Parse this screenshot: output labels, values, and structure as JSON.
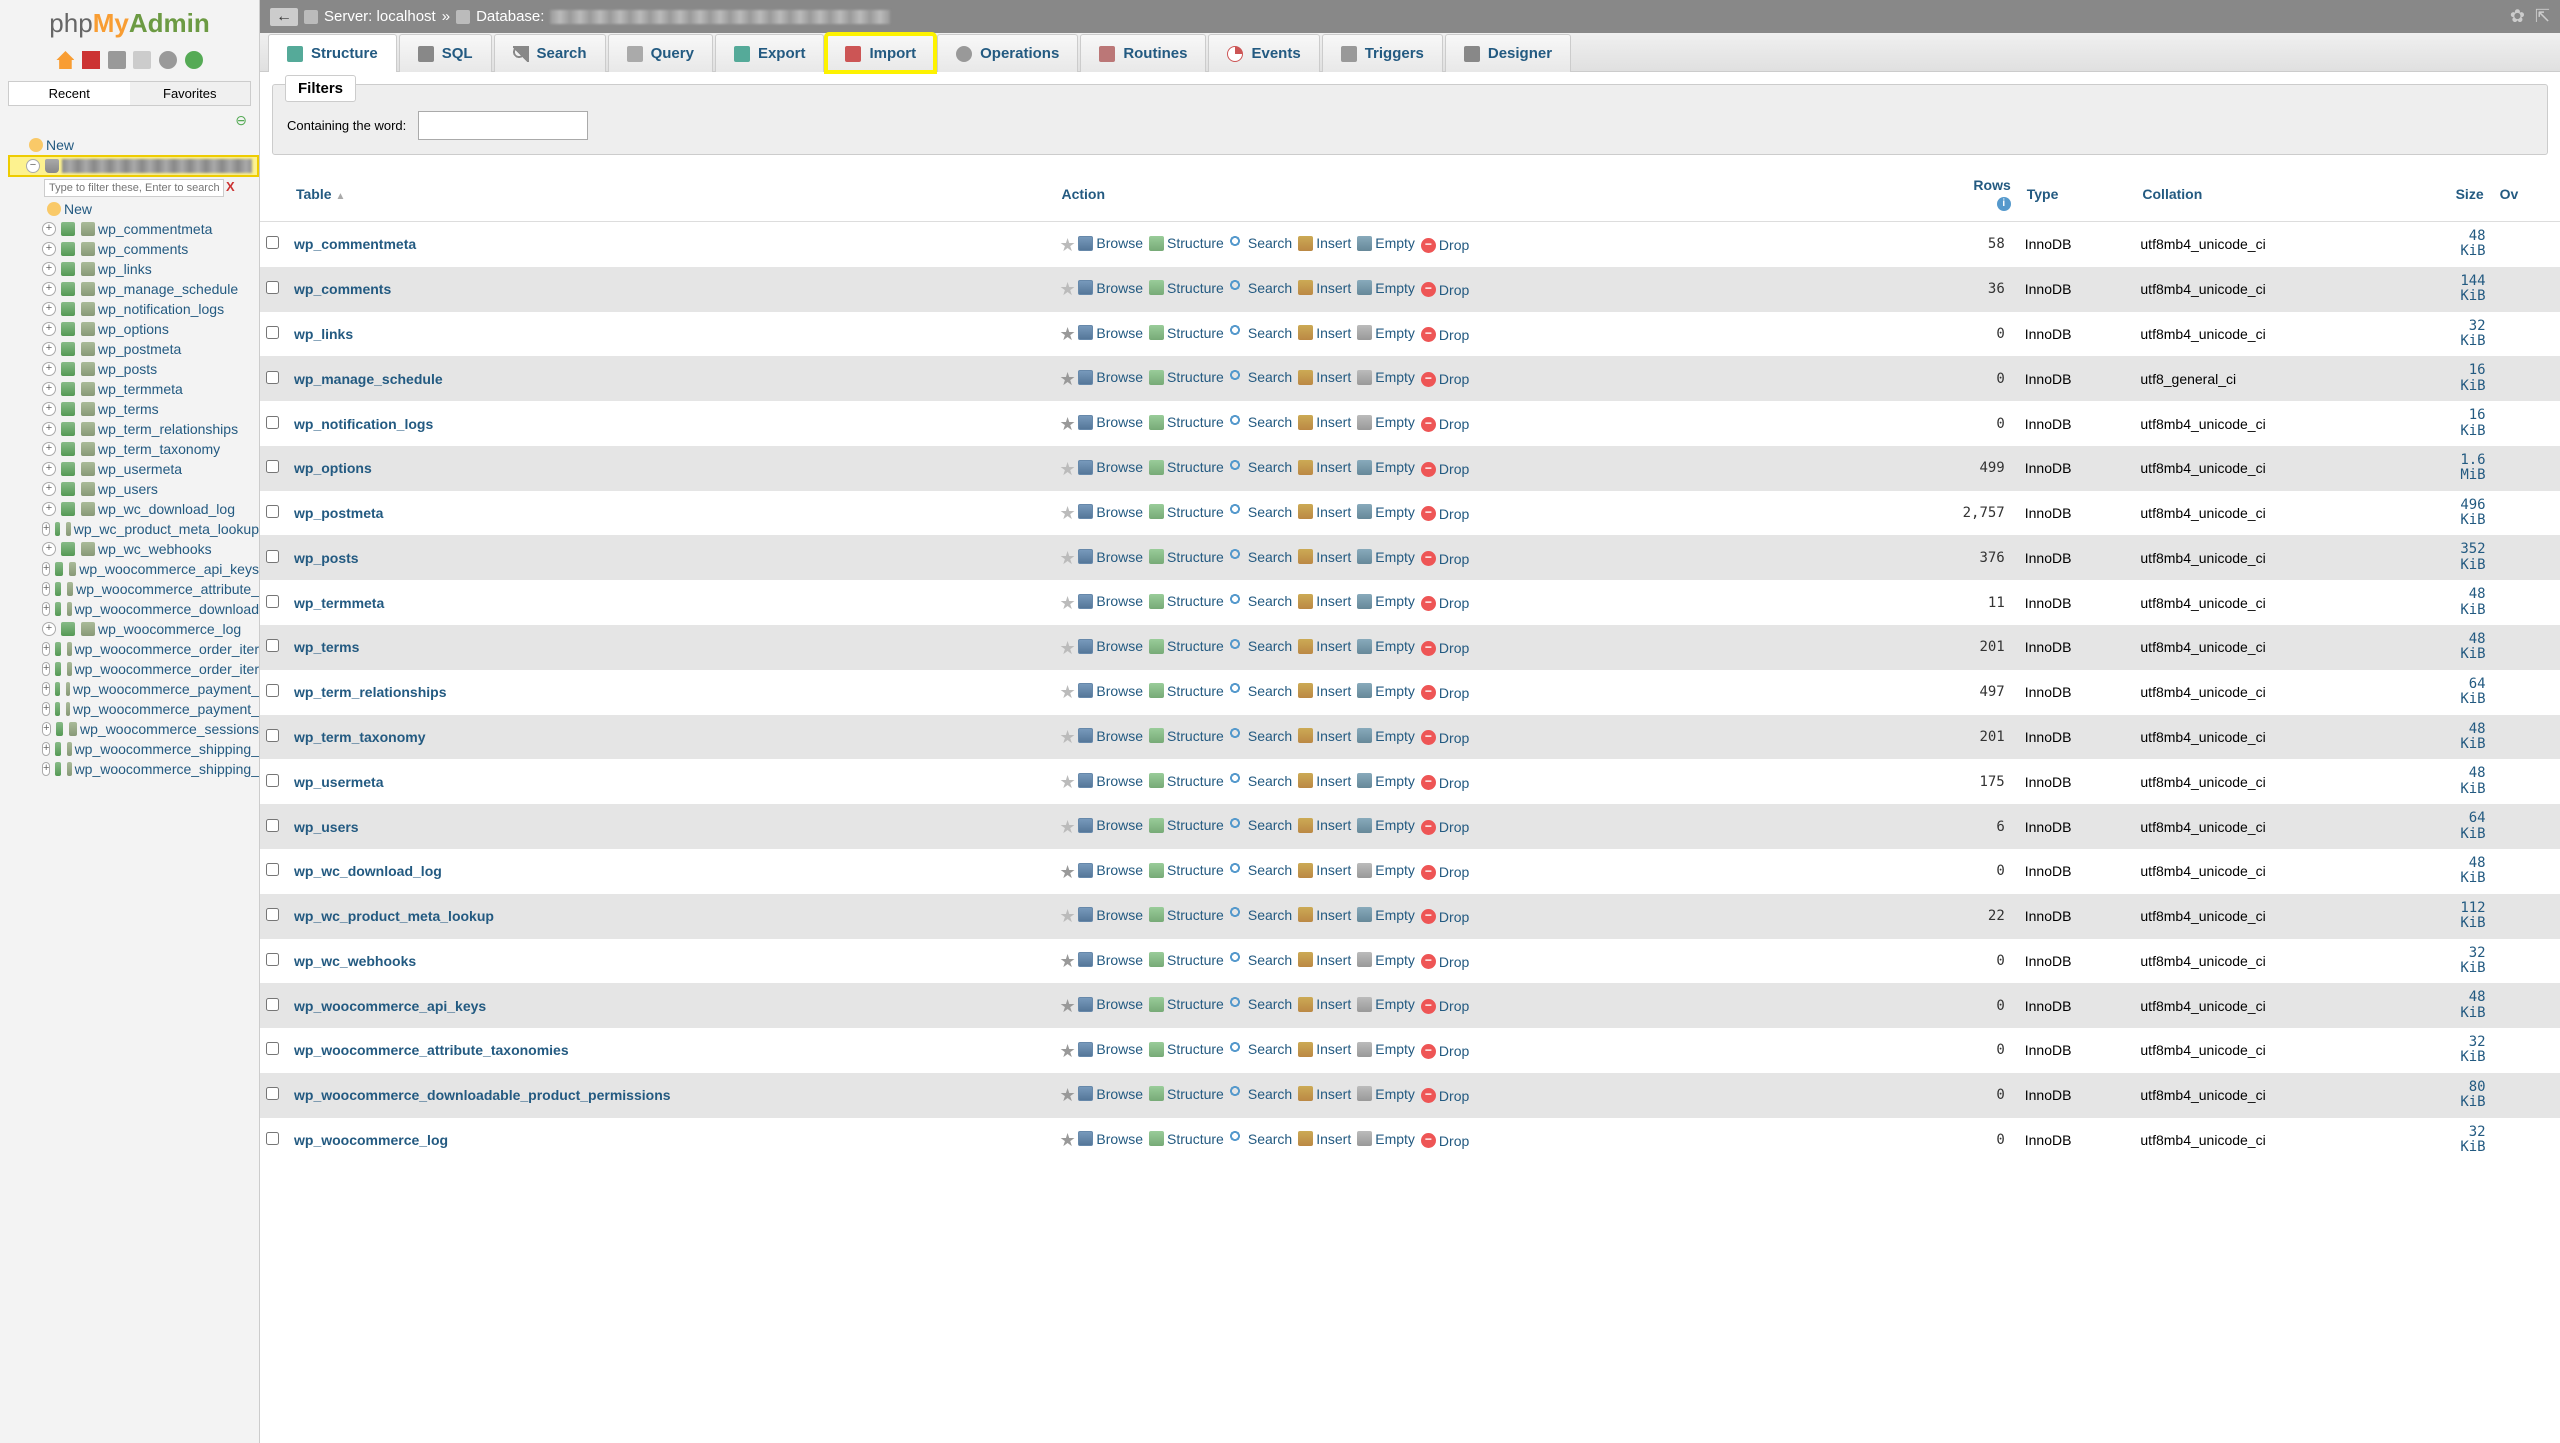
{
  "logo": {
    "php": "php",
    "my": "My",
    "admin": "Admin"
  },
  "sidebar": {
    "recent": "Recent",
    "favorites": "Favorites",
    "new_label": "New",
    "filter_placeholder": "Type to filter these, Enter to search",
    "tree_tables": [
      "wp_commentmeta",
      "wp_comments",
      "wp_links",
      "wp_manage_schedule",
      "wp_notification_logs",
      "wp_options",
      "wp_postmeta",
      "wp_posts",
      "wp_termmeta",
      "wp_terms",
      "wp_term_relationships",
      "wp_term_taxonomy",
      "wp_usermeta",
      "wp_users",
      "wp_wc_download_log",
      "wp_wc_product_meta_lookup",
      "wp_wc_webhooks",
      "wp_woocommerce_api_keys",
      "wp_woocommerce_attribute_",
      "wp_woocommerce_download",
      "wp_woocommerce_log",
      "wp_woocommerce_order_iter",
      "wp_woocommerce_order_iter",
      "wp_woocommerce_payment_",
      "wp_woocommerce_payment_",
      "wp_woocommerce_sessions",
      "wp_woocommerce_shipping_",
      "wp_woocommerce_shipping_"
    ]
  },
  "breadcrumb": {
    "server_label": "Server: localhost",
    "db_label": "Database:"
  },
  "tabs": [
    "Structure",
    "SQL",
    "Search",
    "Query",
    "Export",
    "Import",
    "Operations",
    "Routines",
    "Events",
    "Triggers",
    "Designer"
  ],
  "filters": {
    "legend": "Filters",
    "containing": "Containing the word:"
  },
  "columns": {
    "table": "Table",
    "action": "Action",
    "rows": "Rows",
    "type": "Type",
    "collation": "Collation",
    "size": "Size",
    "overhead": "Ov"
  },
  "actions": {
    "browse": "Browse",
    "structure": "Structure",
    "search": "Search",
    "insert": "Insert",
    "empty": "Empty",
    "drop": "Drop"
  },
  "rows": [
    {
      "name": "wp_commentmeta",
      "rows": "58",
      "type": "InnoDB",
      "coll": "utf8mb4_unicode_ci",
      "size": "48",
      "unit": "KiB",
      "hasdata": true
    },
    {
      "name": "wp_comments",
      "rows": "36",
      "type": "InnoDB",
      "coll": "utf8mb4_unicode_ci",
      "size": "144",
      "unit": "KiB",
      "hasdata": true
    },
    {
      "name": "wp_links",
      "rows": "0",
      "type": "InnoDB",
      "coll": "utf8mb4_unicode_ci",
      "size": "32",
      "unit": "KiB",
      "hasdata": false
    },
    {
      "name": "wp_manage_schedule",
      "rows": "0",
      "type": "InnoDB",
      "coll": "utf8_general_ci",
      "size": "16",
      "unit": "KiB",
      "hasdata": false
    },
    {
      "name": "wp_notification_logs",
      "rows": "0",
      "type": "InnoDB",
      "coll": "utf8mb4_unicode_ci",
      "size": "16",
      "unit": "KiB",
      "hasdata": false
    },
    {
      "name": "wp_options",
      "rows": "499",
      "type": "InnoDB",
      "coll": "utf8mb4_unicode_ci",
      "size": "1.6",
      "unit": "MiB",
      "hasdata": true
    },
    {
      "name": "wp_postmeta",
      "rows": "2,757",
      "type": "InnoDB",
      "coll": "utf8mb4_unicode_ci",
      "size": "496",
      "unit": "KiB",
      "hasdata": true
    },
    {
      "name": "wp_posts",
      "rows": "376",
      "type": "InnoDB",
      "coll": "utf8mb4_unicode_ci",
      "size": "352",
      "unit": "KiB",
      "hasdata": true
    },
    {
      "name": "wp_termmeta",
      "rows": "11",
      "type": "InnoDB",
      "coll": "utf8mb4_unicode_ci",
      "size": "48",
      "unit": "KiB",
      "hasdata": true
    },
    {
      "name": "wp_terms",
      "rows": "201",
      "type": "InnoDB",
      "coll": "utf8mb4_unicode_ci",
      "size": "48",
      "unit": "KiB",
      "hasdata": true
    },
    {
      "name": "wp_term_relationships",
      "rows": "497",
      "type": "InnoDB",
      "coll": "utf8mb4_unicode_ci",
      "size": "64",
      "unit": "KiB",
      "hasdata": true
    },
    {
      "name": "wp_term_taxonomy",
      "rows": "201",
      "type": "InnoDB",
      "coll": "utf8mb4_unicode_ci",
      "size": "48",
      "unit": "KiB",
      "hasdata": true
    },
    {
      "name": "wp_usermeta",
      "rows": "175",
      "type": "InnoDB",
      "coll": "utf8mb4_unicode_ci",
      "size": "48",
      "unit": "KiB",
      "hasdata": true
    },
    {
      "name": "wp_users",
      "rows": "6",
      "type": "InnoDB",
      "coll": "utf8mb4_unicode_ci",
      "size": "64",
      "unit": "KiB",
      "hasdata": true
    },
    {
      "name": "wp_wc_download_log",
      "rows": "0",
      "type": "InnoDB",
      "coll": "utf8mb4_unicode_ci",
      "size": "48",
      "unit": "KiB",
      "hasdata": false
    },
    {
      "name": "wp_wc_product_meta_lookup",
      "rows": "22",
      "type": "InnoDB",
      "coll": "utf8mb4_unicode_ci",
      "size": "112",
      "unit": "KiB",
      "hasdata": true
    },
    {
      "name": "wp_wc_webhooks",
      "rows": "0",
      "type": "InnoDB",
      "coll": "utf8mb4_unicode_ci",
      "size": "32",
      "unit": "KiB",
      "hasdata": false
    },
    {
      "name": "wp_woocommerce_api_keys",
      "rows": "0",
      "type": "InnoDB",
      "coll": "utf8mb4_unicode_ci",
      "size": "48",
      "unit": "KiB",
      "hasdata": false
    },
    {
      "name": "wp_woocommerce_attribute_taxonomies",
      "rows": "0",
      "type": "InnoDB",
      "coll": "utf8mb4_unicode_ci",
      "size": "32",
      "unit": "KiB",
      "hasdata": false
    },
    {
      "name": "wp_woocommerce_downloadable_product_permissions",
      "rows": "0",
      "type": "InnoDB",
      "coll": "utf8mb4_unicode_ci",
      "size": "80",
      "unit": "KiB",
      "hasdata": false
    },
    {
      "name": "wp_woocommerce_log",
      "rows": "0",
      "type": "InnoDB",
      "coll": "utf8mb4_unicode_ci",
      "size": "32",
      "unit": "KiB",
      "hasdata": false
    }
  ]
}
